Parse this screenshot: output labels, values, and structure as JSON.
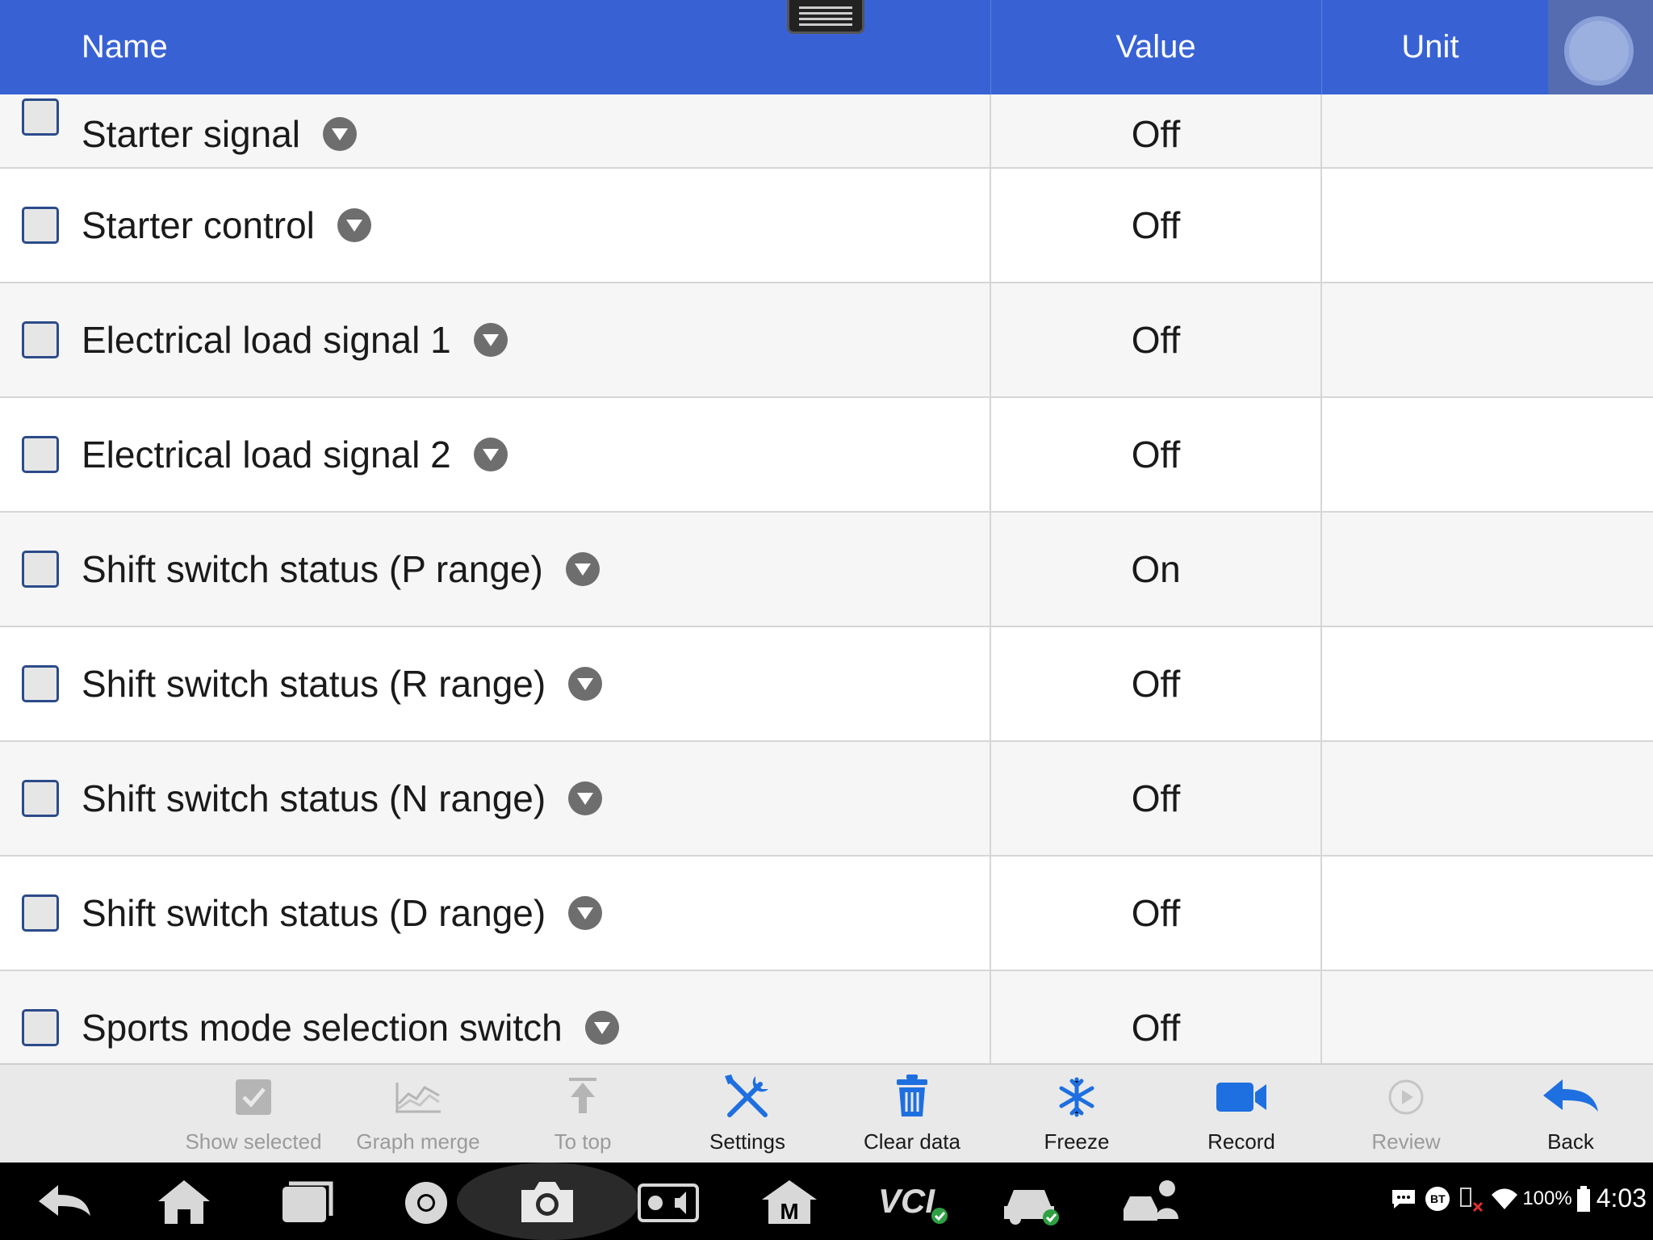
{
  "header": {
    "name_label": "Name",
    "value_label": "Value",
    "unit_label": "Unit"
  },
  "rows": [
    {
      "name": "Starter signal",
      "value": "Off",
      "unit": ""
    },
    {
      "name": "Starter control",
      "value": "Off",
      "unit": ""
    },
    {
      "name": "Electrical load signal 1",
      "value": "Off",
      "unit": ""
    },
    {
      "name": "Electrical load signal 2",
      "value": "Off",
      "unit": ""
    },
    {
      "name": "Shift switch status (P range)",
      "value": "On",
      "unit": ""
    },
    {
      "name": "Shift switch status (R range)",
      "value": "Off",
      "unit": ""
    },
    {
      "name": "Shift switch status (N range)",
      "value": "Off",
      "unit": ""
    },
    {
      "name": "Shift switch status (D range)",
      "value": "Off",
      "unit": ""
    },
    {
      "name": "Sports mode selection switch",
      "value": "Off",
      "unit": ""
    }
  ],
  "toolbar": {
    "show_selected": "Show selected",
    "graph_merge": "Graph merge",
    "to_top": "To top",
    "settings": "Settings",
    "clear_data": "Clear data",
    "freeze": "Freeze",
    "record": "Record",
    "review": "Review",
    "back": "Back"
  },
  "status_bar": {
    "battery": "100%",
    "time": "4:03",
    "bt": "BT",
    "vci": "VCI"
  },
  "colors": {
    "header_bg": "#3862d4",
    "icon_blue": "#1e6fe0",
    "disabled": "#9b9b9b"
  }
}
